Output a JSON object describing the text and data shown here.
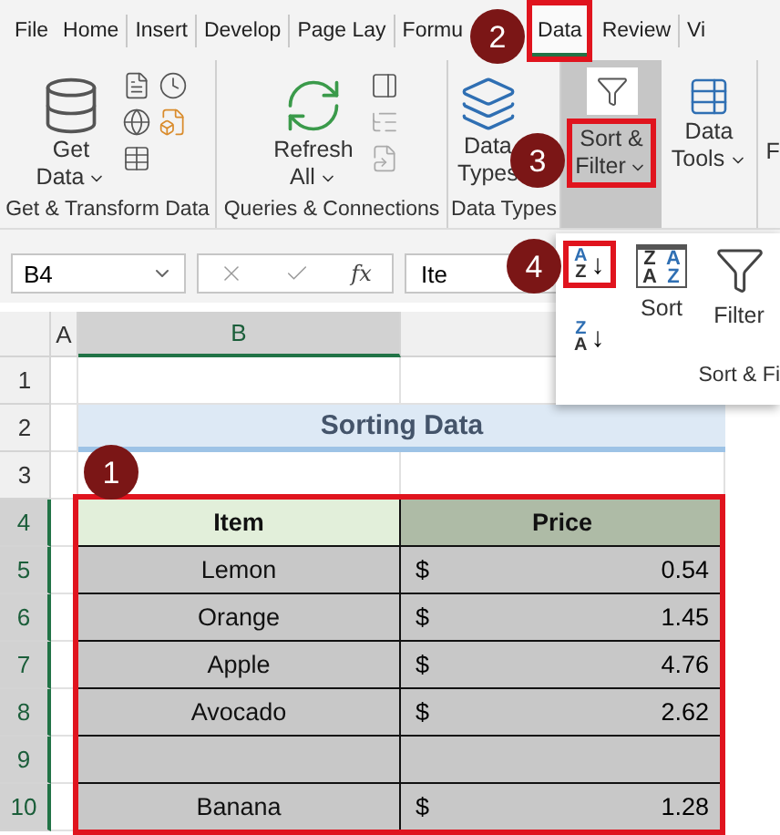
{
  "ribbon_tabs": [
    {
      "label": "File",
      "selected": false,
      "highlighted": false
    },
    {
      "label": "Home",
      "selected": false,
      "highlighted": false
    },
    {
      "label": "Insert",
      "selected": false,
      "highlighted": false
    },
    {
      "label": "Develop",
      "selected": false,
      "highlighted": false
    },
    {
      "label": "Page Lay",
      "selected": false,
      "highlighted": false
    },
    {
      "label": "Formu",
      "selected": false,
      "highlighted": false
    },
    {
      "label": "Data",
      "selected": true,
      "highlighted": true
    },
    {
      "label": "Review",
      "selected": false,
      "highlighted": false
    },
    {
      "label": "Vi",
      "selected": false,
      "highlighted": false
    }
  ],
  "ribbon_groups": [
    {
      "kind": "get",
      "button": [
        "Get",
        "Data"
      ],
      "menu": true,
      "label": "Get & Transform Data"
    },
    {
      "kind": "queries",
      "button": [
        "Refresh",
        "All"
      ],
      "menu": true,
      "label": "Queries & Connections"
    },
    {
      "kind": "types",
      "button": [
        "Data",
        "Types"
      ],
      "menu": false,
      "label": "Data Types"
    },
    {
      "kind": "sort",
      "button": [
        "Sort &",
        "Filter"
      ],
      "menu": true,
      "highlighted": true
    },
    {
      "kind": "tools",
      "button": [
        "Data",
        "Tools"
      ],
      "menu": true
    },
    {
      "kind": "partial",
      "button": [
        "F"
      ],
      "menu": false
    }
  ],
  "formula_bar": {
    "name_box": "B4",
    "fx": "fx",
    "value": "Ite"
  },
  "sort_panel": {
    "ascending": {
      "letters": [
        "A",
        "Z"
      ],
      "arrow": "↓",
      "highlighted": true
    },
    "descending": {
      "letters": [
        "Z",
        "A"
      ],
      "arrow": "↓"
    },
    "sort": {
      "label": "Sort",
      "letters": [
        "Z",
        "A",
        "A",
        "Z"
      ]
    },
    "filter": {
      "label": "Filter"
    },
    "group_label": "Sort & Fi"
  },
  "columns": [
    {
      "label": "A",
      "selected": false
    },
    {
      "label": "B",
      "selected": true
    }
  ],
  "row_headers": [
    {
      "label": "1",
      "selected": false
    },
    {
      "label": "2",
      "selected": false
    },
    {
      "label": "3",
      "selected": false
    },
    {
      "label": "4",
      "selected": true
    },
    {
      "label": "5",
      "selected": true
    },
    {
      "label": "6",
      "selected": true
    },
    {
      "label": "7",
      "selected": true
    },
    {
      "label": "8",
      "selected": true
    },
    {
      "label": "9",
      "selected": true
    },
    {
      "label": "10",
      "selected": true
    }
  ],
  "title": "Sorting Data",
  "table": {
    "highlighted": true,
    "headers": [
      "Item",
      "Price"
    ],
    "rows": [
      {
        "kind": "item",
        "item": "Lemon",
        "currency": "$",
        "price": "0.54"
      },
      {
        "kind": "item",
        "item": "Orange",
        "currency": "$",
        "price": "1.45"
      },
      {
        "kind": "item",
        "item": "Apple",
        "currency": "$",
        "price": "4.76"
      },
      {
        "kind": "item",
        "item": "Avocado",
        "currency": "$",
        "price": "2.62"
      },
      {
        "kind": "blank"
      },
      {
        "kind": "item",
        "item": "Banana",
        "currency": "$",
        "price": "1.28"
      }
    ]
  },
  "callouts": [
    "1",
    "2",
    "3",
    "4"
  ]
}
